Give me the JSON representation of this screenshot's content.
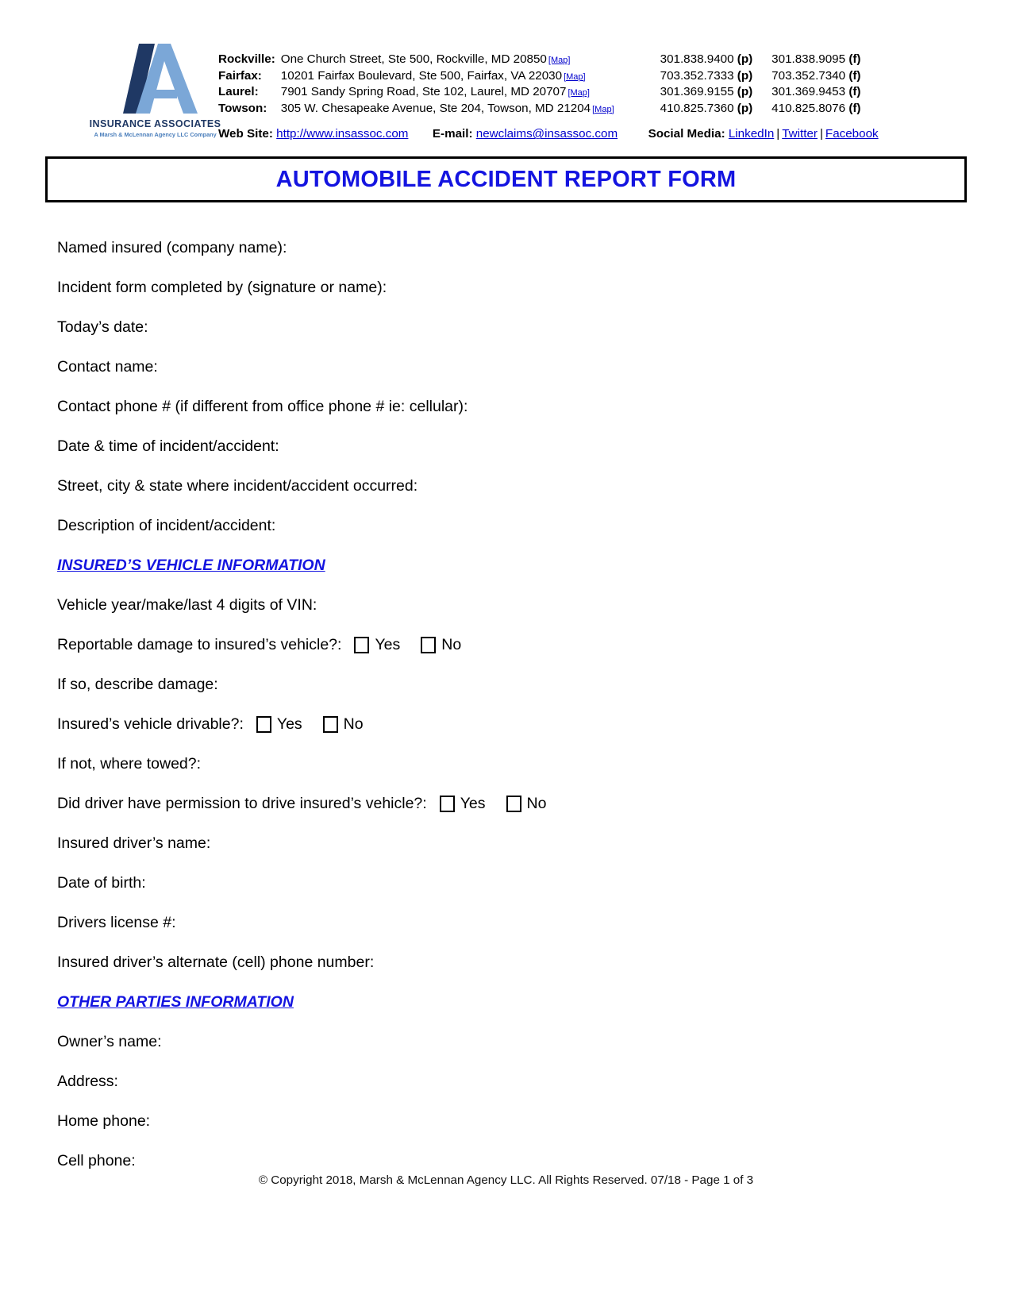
{
  "header": {
    "logo": {
      "name": "INSURANCE ASSOCIATES",
      "tagline": "A Marsh & McLennan Agency LLC Company",
      "navy": "#1f3864",
      "light_blue": "#7ba7d7"
    },
    "offices": [
      {
        "city": "Rockville:",
        "address": "One Church Street, Ste 500, Rockville, MD 20850",
        "map_label": "[Map]",
        "phone": "301.838.9400",
        "phone_tag": "(p)",
        "fax": "301.838.9095",
        "fax_tag": "(f)"
      },
      {
        "city": "Fairfax:",
        "address": "10201 Fairfax Boulevard, Ste 500, Fairfax, VA 22030",
        "map_label": "[Map]",
        "phone": "703.352.7333",
        "phone_tag": "(p)",
        "fax": "703.352.7340",
        "fax_tag": "(f)"
      },
      {
        "city": "Laurel:",
        "address": "7901 Sandy Spring Road, Ste 102, Laurel, MD 20707",
        "map_label": "[Map]",
        "phone": "301.369.9155",
        "phone_tag": "(p)",
        "fax": "301.369.9453",
        "fax_tag": "(f)"
      },
      {
        "city": "Towson:",
        "address": "305 W. Chesapeake Avenue, Ste 204, Towson, MD 21204",
        "map_label": "[Map]",
        "phone": "410.825.7360",
        "phone_tag": "(p)",
        "fax": "410.825.8076",
        "fax_tag": "(f)"
      }
    ],
    "web": {
      "website_label": "Web Site:",
      "website_url": "http://www.insassoc.com",
      "email_label": "E-mail:",
      "email_address": "newclaims@insassoc.com",
      "social_label": "Social Media:",
      "social_links": [
        "LinkedIn",
        "Twitter",
        "Facebook"
      ],
      "separator": "|",
      "link_color": "#0000cc"
    }
  },
  "title": {
    "text": "AUTOMOBILE ACCIDENT REPORT FORM",
    "color": "#1414e0"
  },
  "form": {
    "general_fields": [
      "Named insured (company name):",
      "Incident form completed by (signature or name):",
      "Today’s date:",
      "Contact name:",
      "Contact phone # (if different from office phone # ie: cellular):",
      "Date & time of incident/accident:",
      "Street, city & state where incident/accident occurred:",
      "Description of incident/accident:"
    ],
    "section_vehicle": {
      "heading": "INSURED’S VEHICLE INFORMATION",
      "rows": [
        {
          "type": "text",
          "label": "Vehicle year/make/last 4 digits of VIN:"
        },
        {
          "type": "choice",
          "label": "Reportable damage to insured’s vehicle?:",
          "options": [
            "Yes",
            "No"
          ]
        },
        {
          "type": "text",
          "label": "If so, describe damage:"
        },
        {
          "type": "choice",
          "label": "Insured’s vehicle drivable?:",
          "options": [
            "Yes",
            "No"
          ]
        },
        {
          "type": "text",
          "label": "If not, where towed?:"
        },
        {
          "type": "choice",
          "label": "Did driver have permission to drive insured’s vehicle?:",
          "options": [
            "Yes",
            "No"
          ]
        },
        {
          "type": "text",
          "label": "Insured driver’s name:"
        },
        {
          "type": "text",
          "label": "Date of birth:"
        },
        {
          "type": "text",
          "label": "Drivers license #:"
        },
        {
          "type": "text",
          "label": "Insured driver’s alternate (cell) phone number:"
        }
      ]
    },
    "section_other": {
      "heading": "OTHER PARTIES INFORMATION",
      "rows": [
        {
          "type": "text",
          "label": "Owner’s name:"
        },
        {
          "type": "text",
          "label": "Address:"
        },
        {
          "type": "text",
          "label": "Home phone:"
        },
        {
          "type": "text",
          "label": "Cell phone:"
        }
      ]
    }
  },
  "footer": {
    "copyright": "© Copyright 2018, Marsh & McLennan Agency LLC. All Rights Reserved. 07/18 - Page 1 of 3"
  }
}
